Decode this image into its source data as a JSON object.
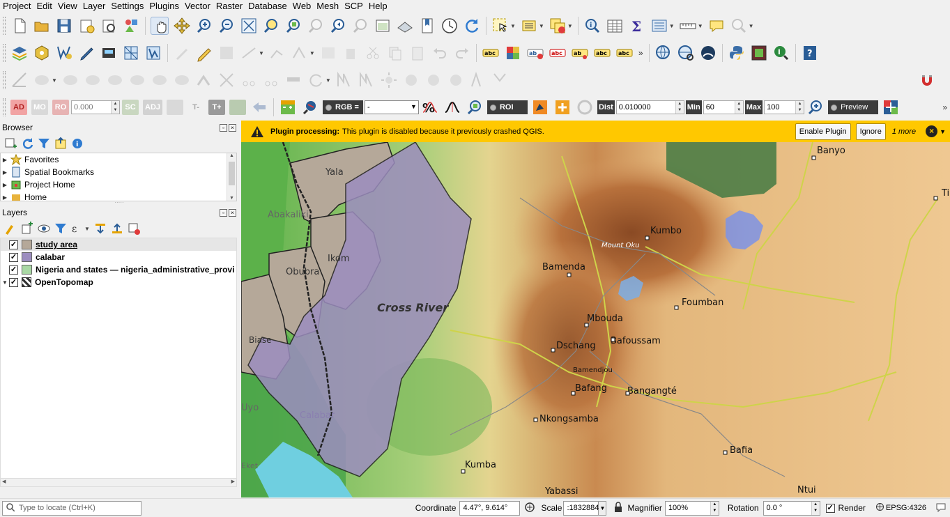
{
  "menu": [
    "Project",
    "Edit",
    "View",
    "Layer",
    "Settings",
    "Plugins",
    "Vector",
    "Raster",
    "Database",
    "Web",
    "Mesh",
    "SCP",
    "Help"
  ],
  "toolbar4": {
    "ad": "AD",
    "mo": "MO",
    "ro": "RO",
    "spin_value": "0.000",
    "sc": "SC",
    "adj": "ADJ",
    "t_minus": "T-",
    "t_plus": "T+",
    "rgb_label": "RGB =",
    "rgb_value": "-",
    "roi_label": "ROI",
    "dist_label": "Dist",
    "dist_value": "0.010000",
    "min_label": "Min",
    "min_value": "60",
    "max_label": "Max",
    "max_value": "100",
    "preview_label": "Preview"
  },
  "browser": {
    "title": "Browser",
    "items": [
      {
        "label": "Favorites"
      },
      {
        "label": "Spatial Bookmarks"
      },
      {
        "label": "Project Home"
      },
      {
        "label": "Home"
      }
    ]
  },
  "layers": {
    "title": "Layers",
    "items": [
      {
        "label": "study area",
        "color": "#b5a899",
        "checked": true
      },
      {
        "label": "calabar",
        "color": "#9c8dbf",
        "checked": true
      },
      {
        "label": "Nigeria and states — nigeria_administrative_provi",
        "color": "#a9d8a4",
        "checked": true
      },
      {
        "label": "OpenTopomap",
        "color": "",
        "checked": true
      }
    ]
  },
  "message_bar": {
    "title": "Plugin processing:",
    "text": "This plugin is disabled because it previously crashed QGIS.",
    "enable_button": "Enable Plugin",
    "ignore_button": "Ignore",
    "more": "1 more"
  },
  "map": {
    "labels": {
      "yala": "Yala",
      "abakaliki": "Abakaliki",
      "ikom": "Ikom",
      "obubra": "Obubra",
      "cross_river": "Cross River",
      "biase": "Biase",
      "calabar": "Calabar",
      "uyo": "Uyo",
      "eket": "Eket",
      "kumba": "Kumba",
      "yabassi": "Yabassi",
      "nkongsamba": "Nkongsamba",
      "bafang": "Bafang",
      "bangangte": "Bangangté",
      "bamendjou": "Bamendjou",
      "dschang": "Dschang",
      "bafoussam": "Bafoussam",
      "mbouda": "Mbouda",
      "foumban": "Foumban",
      "bamenda": "Bamenda",
      "mount_oku": "Mount Oku",
      "kumbo": "Kumbo",
      "banyo": "Banyo",
      "tib": "Tib",
      "bafia": "Bafia",
      "ntui": "Ntui"
    }
  },
  "status": {
    "locate_placeholder": "Type to locate (Ctrl+K)",
    "coordinate_label": "Coordinate",
    "coordinate_value": "4.47°, 9.614°",
    "scale_label": "Scale",
    "scale_value": ":1832884",
    "magnifier_label": "Magnifier",
    "magnifier_value": "100%",
    "rotation_label": "Rotation",
    "rotation_value": "0.0 °",
    "render_label": "Render",
    "crs": "EPSG:4326"
  }
}
